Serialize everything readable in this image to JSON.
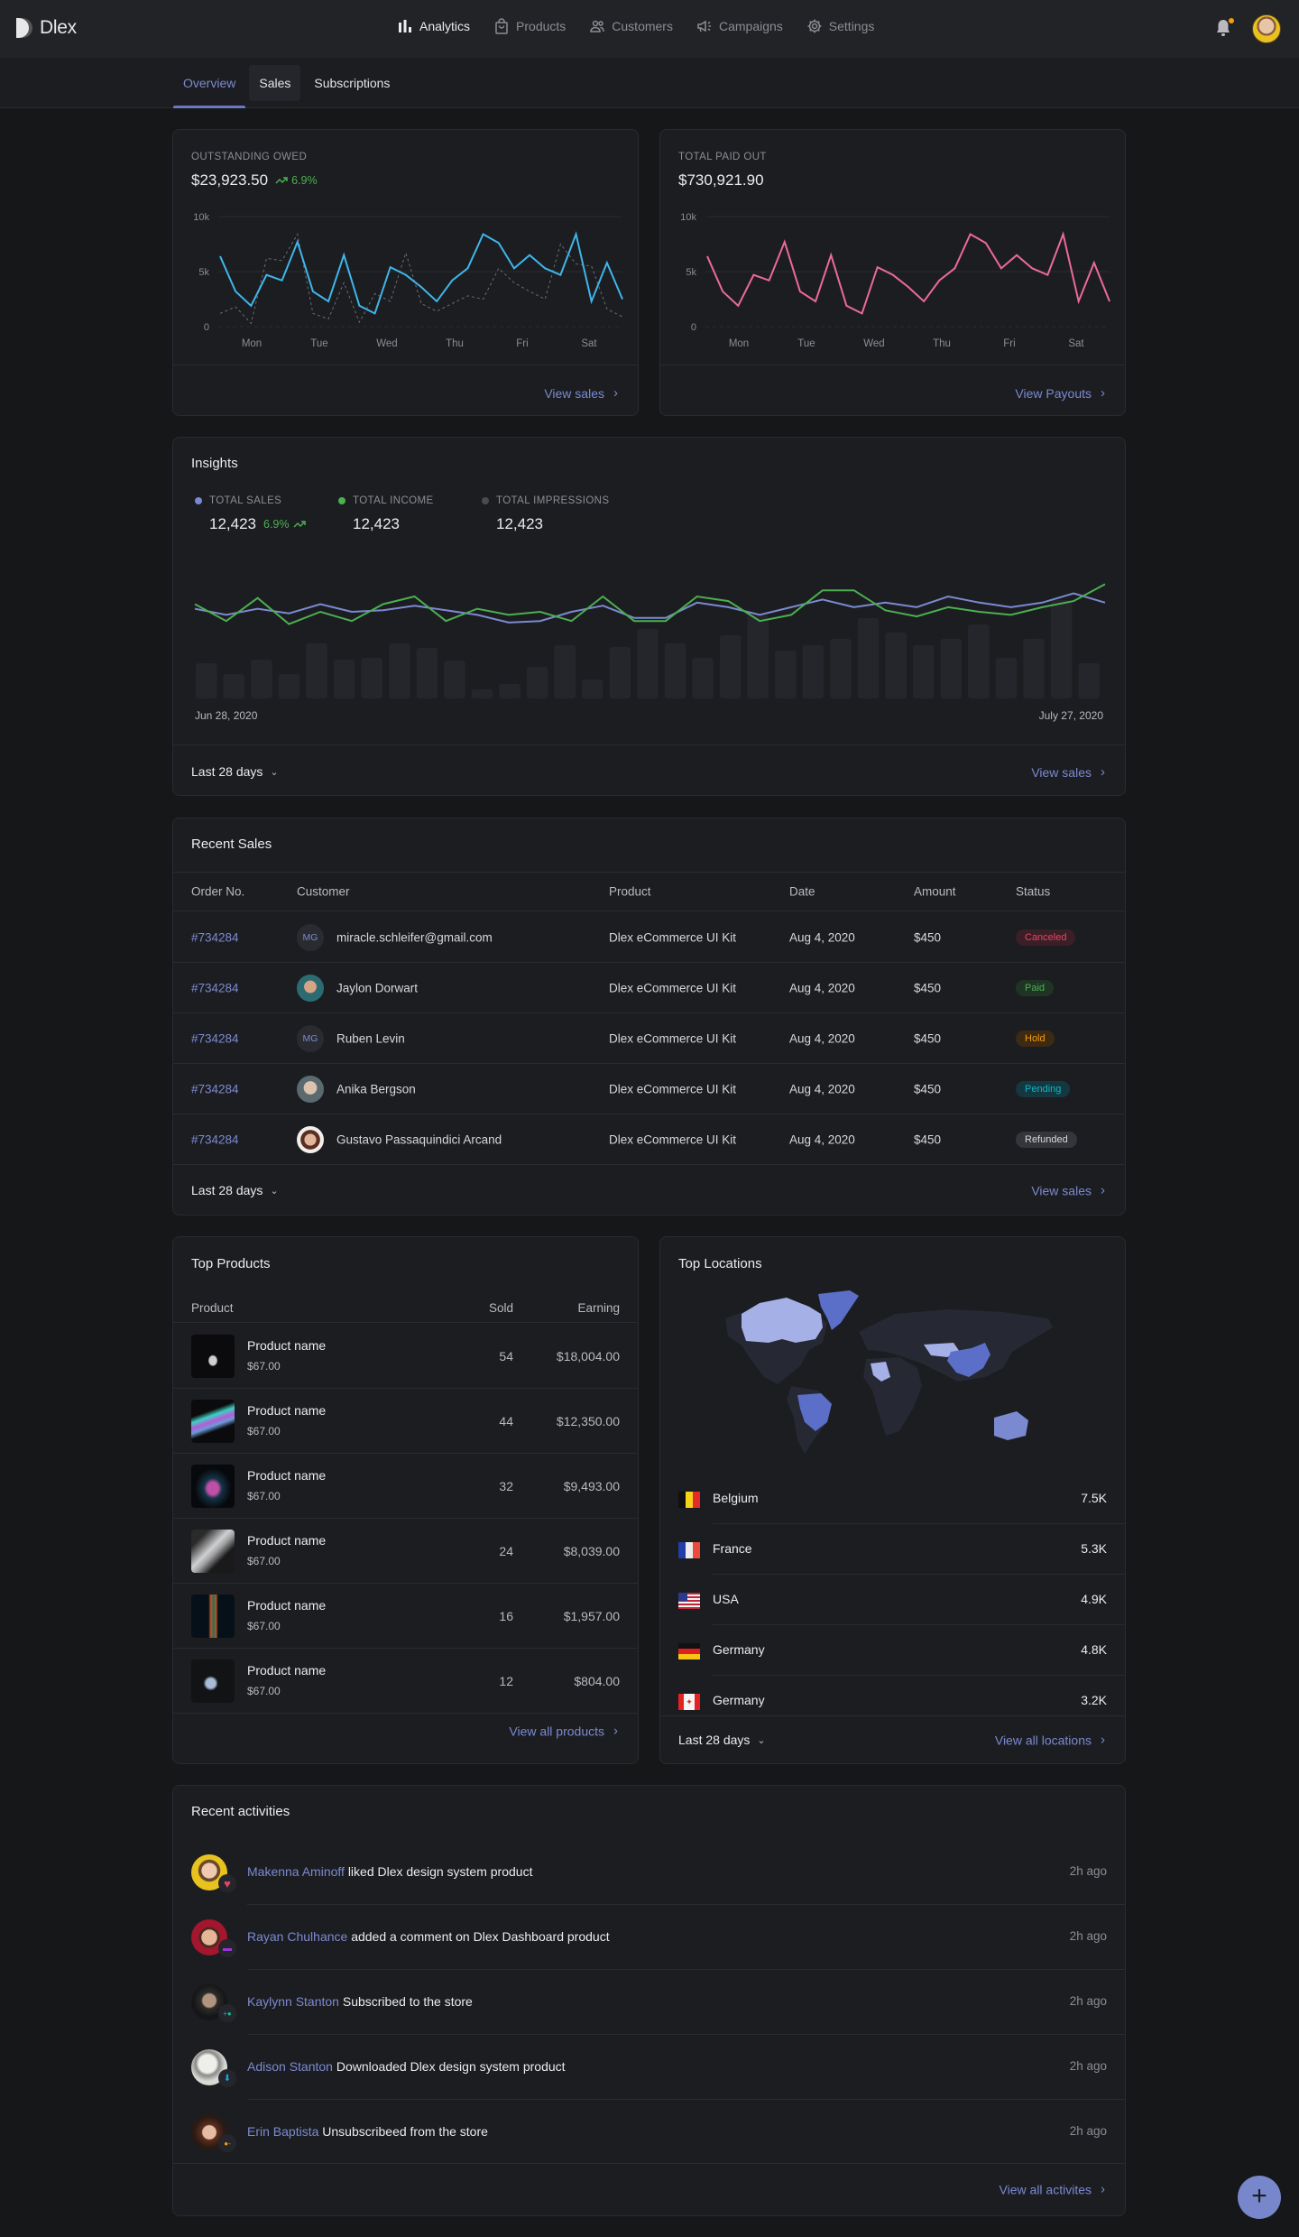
{
  "app": {
    "name": "Dlex"
  },
  "nav": [
    {
      "label": "Analytics",
      "icon": "bar-chart-icon",
      "active": true
    },
    {
      "label": "Products",
      "icon": "shopping-bag-icon",
      "active": false
    },
    {
      "label": "Customers",
      "icon": "users-icon",
      "active": false
    },
    {
      "label": "Campaigns",
      "icon": "megaphone-icon",
      "active": false
    },
    {
      "label": "Settings",
      "icon": "gear-icon",
      "active": false
    }
  ],
  "tabs": [
    {
      "label": "Overview",
      "active": true
    },
    {
      "label": "Sales",
      "active": false
    },
    {
      "label": "Subscriptions",
      "active": false
    }
  ],
  "outstanding": {
    "label": "OUTSTANDING OWED",
    "amount": "$23,923.50",
    "trend": "6.9%",
    "link": "View sales"
  },
  "paid_out": {
    "label": "TOTAL PAID OUT",
    "amount": "$730,921.90",
    "link": "View Payouts"
  },
  "insights": {
    "title": "Insights",
    "kpis": [
      {
        "label": "TOTAL SALES",
        "value": "12,423",
        "trend": "6.9%",
        "color": "#7b8ad0"
      },
      {
        "label": "TOTAL INCOME",
        "value": "12,423",
        "color": "#4caf50"
      },
      {
        "label": "TOTAL IMPRESSIONS",
        "value": "12,423",
        "color": "#4a4b50"
      }
    ],
    "start_date": "Jun 28, 2020",
    "end_date": "July 27, 2020",
    "range": "Last 28 days",
    "link": "View sales"
  },
  "chart_data": [
    {
      "type": "line",
      "title": "OUTSTANDING OWED",
      "categories": [
        "Mon",
        "Tue",
        "Wed",
        "Thu",
        "Fri",
        "Sat"
      ],
      "yticks": [
        "0",
        "5k",
        "10k"
      ],
      "ylim": [
        0,
        10000
      ],
      "grid": true,
      "series": [
        {
          "name": "current",
          "color": "#3fb6ea",
          "style": "solid",
          "values": [
            6400,
            3200,
            1900,
            4700,
            4200,
            7700,
            3200,
            2300,
            6500,
            1900,
            1200,
            5400,
            4700,
            3600,
            2300,
            4200,
            5300,
            8400,
            7600,
            5300,
            6500,
            5300,
            4700,
            8400,
            2300,
            5800,
            2500
          ]
        },
        {
          "name": "previous",
          "color": "#6b6c72",
          "style": "dashed",
          "values": [
            1200,
            1800,
            300,
            6200,
            6000,
            8400,
            1200,
            700,
            4000,
            400,
            3000,
            2300,
            6700,
            2100,
            1400,
            2100,
            2800,
            2500,
            5300,
            4000,
            3200,
            2500,
            7500,
            5700,
            5500,
            1600,
            900
          ]
        }
      ]
    },
    {
      "type": "line",
      "title": "TOTAL PAID OUT",
      "categories": [
        "Mon",
        "Tue",
        "Wed",
        "Thu",
        "Fri",
        "Sat"
      ],
      "yticks": [
        "0",
        "5k",
        "10k"
      ],
      "ylim": [
        0,
        10000
      ],
      "grid": true,
      "series": [
        {
          "name": "paid out",
          "color": "#ec6a9a",
          "style": "solid",
          "values": [
            6400,
            3200,
            1900,
            4700,
            4200,
            7700,
            3200,
            2300,
            6500,
            1900,
            1200,
            5400,
            4700,
            3600,
            2300,
            4200,
            5300,
            8400,
            7600,
            5300,
            6500,
            5300,
            4700,
            8400,
            2300,
            5800,
            2300
          ]
        }
      ]
    },
    {
      "type": "bar+line",
      "title": "Insights",
      "x_start": "Jun 28, 2020",
      "x_end": "July 27, 2020",
      "bars": {
        "name": "Total impressions",
        "color": "#25262b",
        "values": [
          39,
          27,
          43,
          27,
          61,
          43,
          45,
          61,
          56,
          42,
          10,
          16,
          35,
          59,
          21,
          57,
          77,
          61,
          45,
          70,
          92,
          53,
          59,
          66,
          89,
          73,
          59,
          66,
          82,
          45,
          66,
          109,
          39
        ]
      },
      "series": [
        {
          "name": "Total sales",
          "color": "#7b8ad0",
          "values": [
            62,
            58,
            62,
            59,
            65,
            60,
            61,
            64,
            61,
            58,
            53,
            54,
            60,
            64,
            56,
            56,
            66,
            63,
            58,
            63,
            68,
            63,
            66,
            63,
            70,
            66,
            63,
            66,
            72,
            66
          ]
        },
        {
          "name": "Total income",
          "color": "#4caf50",
          "values": [
            65,
            54,
            69,
            52,
            60,
            54,
            65,
            70,
            54,
            62,
            58,
            60,
            54,
            70,
            54,
            54,
            70,
            67,
            54,
            58,
            74,
            74,
            61,
            57,
            63,
            60,
            58,
            63,
            67,
            78
          ]
        }
      ]
    }
  ],
  "recent_sales": {
    "title": "Recent Sales",
    "columns": [
      "Order No.",
      "Customer",
      "Product",
      "Date",
      "Amount",
      "Status"
    ],
    "rows": [
      {
        "order": "#734284",
        "customer": "miracle.schleifer@gmail.com",
        "initials": "MG",
        "product": "Dlex eCommerce UI Kit",
        "date": "Aug 4, 2020",
        "amount": "$450",
        "status": "Canceled"
      },
      {
        "order": "#734284",
        "customer": "Jaylon Dorwart",
        "product": "Dlex eCommerce UI Kit",
        "date": "Aug 4, 2020",
        "amount": "$450",
        "status": "Paid"
      },
      {
        "order": "#734284",
        "customer": "Ruben Levin",
        "initials": "MG",
        "product": "Dlex eCommerce UI Kit",
        "date": "Aug 4, 2020",
        "amount": "$450",
        "status": "Hold"
      },
      {
        "order": "#734284",
        "customer": "Anika Bergson",
        "product": "Dlex eCommerce UI Kit",
        "date": "Aug 4, 2020",
        "amount": "$450",
        "status": "Pending"
      },
      {
        "order": "#734284",
        "customer": "Gustavo Passaquindici Arcand",
        "product": "Dlex eCommerce UI Kit",
        "date": "Aug 4, 2020",
        "amount": "$450",
        "status": "Refunded"
      }
    ],
    "range": "Last 28 days",
    "link": "View sales"
  },
  "top_products": {
    "title": "Top Products",
    "columns": [
      "Product",
      "Sold",
      "Earning"
    ],
    "rows": [
      {
        "name": "Product name",
        "price": "$67.00",
        "sold": "54",
        "earning": "$18,004.00"
      },
      {
        "name": "Product name",
        "price": "$67.00",
        "sold": "44",
        "earning": "$12,350.00"
      },
      {
        "name": "Product name",
        "price": "$67.00",
        "sold": "32",
        "earning": "$9,493.00"
      },
      {
        "name": "Product name",
        "price": "$67.00",
        "sold": "24",
        "earning": "$8,039.00"
      },
      {
        "name": "Product name",
        "price": "$67.00",
        "sold": "16",
        "earning": "$1,957.00"
      },
      {
        "name": "Product name",
        "price": "$67.00",
        "sold": "12",
        "earning": "$804.00"
      }
    ],
    "link": "View all products"
  },
  "top_locations": {
    "title": "Top Locations",
    "rows": [
      {
        "country": "Belgium",
        "flag": "belgium-flag-icon",
        "value": "7.5K"
      },
      {
        "country": "France",
        "flag": "france-flag-icon",
        "value": "5.3K"
      },
      {
        "country": "USA",
        "flag": "usa-flag-icon",
        "value": "4.9K"
      },
      {
        "country": "Germany",
        "flag": "germany-flag-icon",
        "value": "4.8K"
      },
      {
        "country": "Germany",
        "flag": "canada-flag-icon",
        "value": "3.2K"
      }
    ],
    "range": "Last 28 days",
    "link": "View all locations"
  },
  "activities": {
    "title": "Recent activities",
    "rows": [
      {
        "who": "Makenna Aminoff",
        "action": "liked Dlex design system product",
        "time": "2h ago",
        "badge": "heart-icon"
      },
      {
        "who": "Rayan Chulhance",
        "action": "added a comment on Dlex Dashboard product",
        "time": "2h ago",
        "badge": "comment-icon"
      },
      {
        "who": "Kaylynn Stanton",
        "action": "Subscribed to the store",
        "time": "2h ago",
        "badge": "user-add-icon"
      },
      {
        "who": "Adison Stanton",
        "action": "Downloaded Dlex design system product",
        "time": "2h ago",
        "badge": "download-icon"
      },
      {
        "who": "Erin Baptista",
        "action": "Unsubscribeed from the store",
        "time": "2h ago",
        "badge": "user-remove-icon"
      }
    ],
    "link": "View all activites"
  },
  "fab": {
    "label": "+"
  }
}
